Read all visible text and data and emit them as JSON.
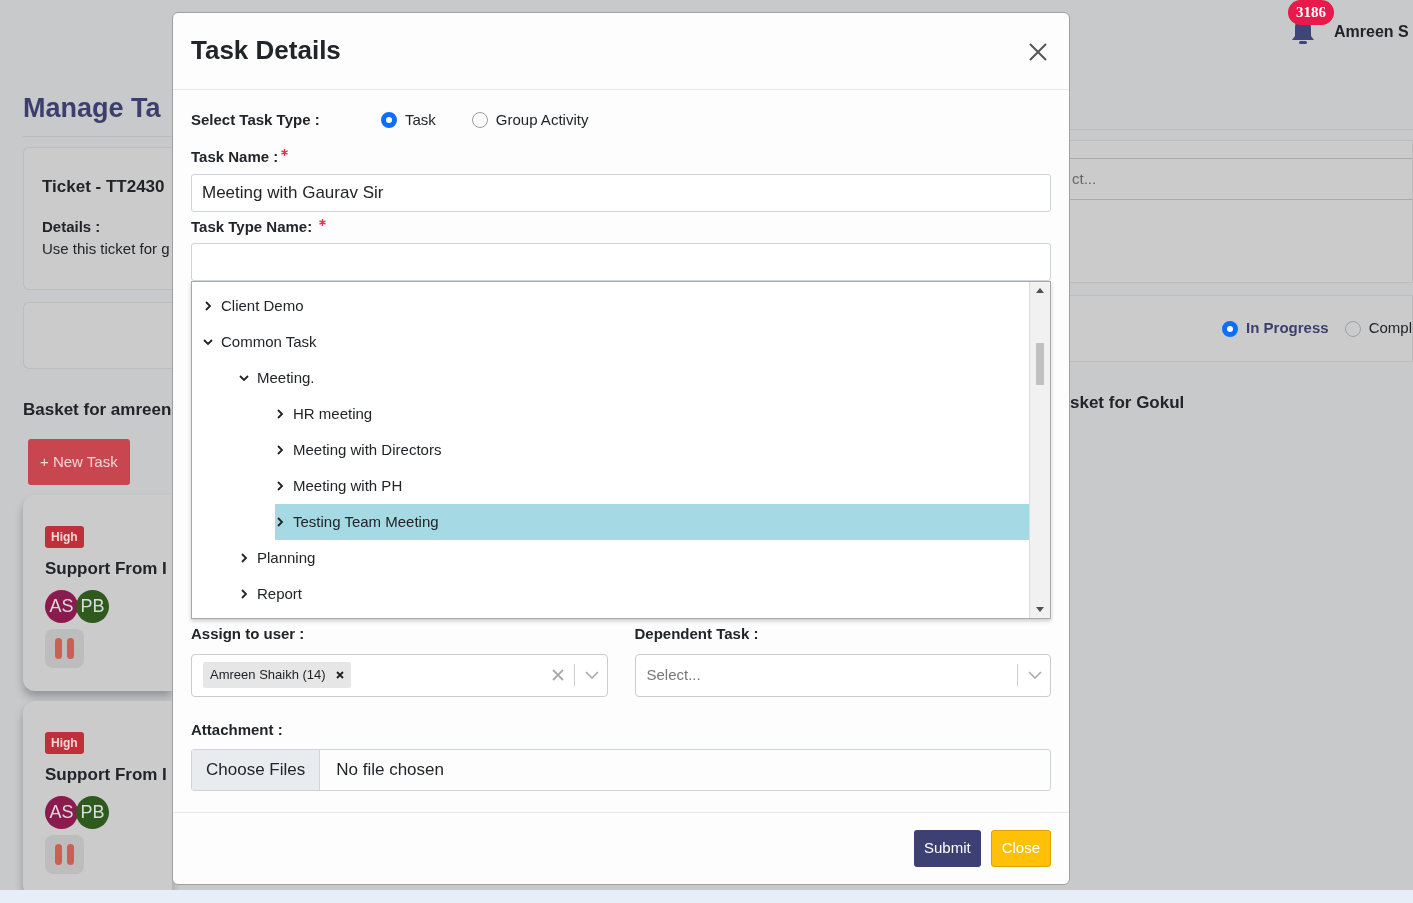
{
  "page": {
    "title": "Manage Ta",
    "ticket": {
      "title": "Ticket - TT2430",
      "details_label": "Details :",
      "details_text": "Use this ticket for g"
    },
    "left_basket": {
      "title": "Basket for amreen",
      "new_task_button": "+ New Task",
      "tasks": [
        {
          "priority": "High",
          "title": "Support From I",
          "assignees": [
            {
              "initials": "AS",
              "color": "#8b1a4f"
            },
            {
              "initials": "PB",
              "color": "#2e5a1e"
            }
          ]
        },
        {
          "priority": "High",
          "title": "Support From I",
          "assignees": [
            {
              "initials": "AS",
              "color": "#8b1a4f"
            },
            {
              "initials": "PB",
              "color": "#2e5a1e"
            }
          ]
        }
      ]
    },
    "header": {
      "notification_count": "3186",
      "user_name": "Amreen S"
    },
    "filter": {
      "placeholder": "ct..."
    },
    "status_options": [
      {
        "label": "In Progress",
        "selected": true
      },
      {
        "label": "Compl",
        "selected": false
      }
    ],
    "right_basket": {
      "title": "sket for Gokul"
    }
  },
  "modal": {
    "title": "Task Details",
    "task_type": {
      "label": "Select Task Type :",
      "options": [
        {
          "label": "Task",
          "selected": true
        },
        {
          "label": "Group Activity",
          "selected": false
        }
      ]
    },
    "task_name": {
      "label": "Task Name :",
      "required": true,
      "value": "Meeting with Gaurav Sir"
    },
    "task_type_name": {
      "label": "Task Type Name:",
      "required": true
    },
    "tree": [
      {
        "label": "Client Demo",
        "expanded": false,
        "selected": false
      },
      {
        "label": "Common Task",
        "expanded": true,
        "selected": false,
        "children": [
          {
            "label": "Meeting.",
            "expanded": true,
            "selected": false,
            "children": [
              {
                "label": "HR meeting",
                "expanded": false,
                "selected": false
              },
              {
                "label": "Meeting with Directors",
                "expanded": false,
                "selected": false
              },
              {
                "label": "Meeting with PH",
                "expanded": false,
                "selected": false
              },
              {
                "label": "Testing Team Meeting",
                "expanded": false,
                "selected": true
              }
            ]
          },
          {
            "label": "Planning",
            "expanded": false,
            "selected": false
          },
          {
            "label": "Report",
            "expanded": false,
            "selected": false
          }
        ]
      }
    ],
    "assign": {
      "label": "Assign to user :",
      "tags": [
        "Amreen Shaikh (14)"
      ]
    },
    "dependent": {
      "label": "Dependent Task :",
      "placeholder": "Select..."
    },
    "attachment": {
      "label": "Attachment :",
      "button": "Choose Files",
      "status": "No file chosen"
    },
    "buttons": [
      {
        "label": "Submit",
        "kind": "primary"
      },
      {
        "label": "Close",
        "kind": "warning"
      }
    ]
  }
}
